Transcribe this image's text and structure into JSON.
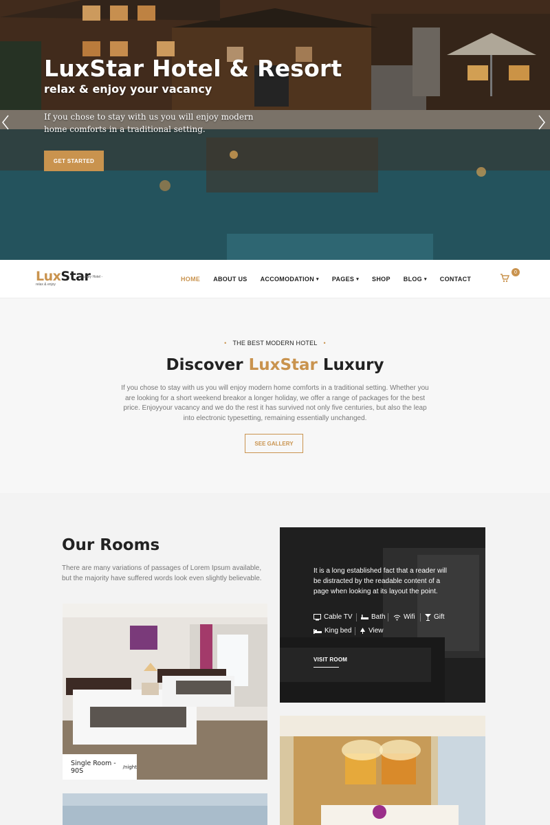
{
  "hero": {
    "title": "LuxStar Hotel & Resort",
    "subtitle": "relax & enjoy your vacancy",
    "text": "If you chose to stay with us you will enjoy modern home comforts in a traditional setting.",
    "button": "GET STARTED",
    "prev_icon": "chevron-left-icon",
    "next_icon": "chevron-right-icon"
  },
  "logo": {
    "lux": "Lux",
    "star": "Star",
    "tagline": "- Luxury Hotel -",
    "sub": "relax & enjoy"
  },
  "nav": {
    "items": [
      {
        "label": "HOME",
        "active": true,
        "dropdown": false
      },
      {
        "label": "ABOUT US",
        "active": false,
        "dropdown": false
      },
      {
        "label": "ACCOMODATION",
        "active": false,
        "dropdown": true
      },
      {
        "label": "PAGES",
        "active": false,
        "dropdown": true
      },
      {
        "label": "SHOP",
        "active": false,
        "dropdown": false
      },
      {
        "label": "BLOG",
        "active": false,
        "dropdown": true
      },
      {
        "label": "CONTACT",
        "active": false,
        "dropdown": false
      }
    ],
    "cart_count": "0"
  },
  "about": {
    "eyebrow": "THE BEST MODERN HOTEL",
    "title_before": "Discover ",
    "title_accent": "LuxStar",
    "title_after": " Luxury",
    "text": "If you chose to stay with us you will enjoy modern home comforts in a traditional setting. Whether you are looking for a short weekend breakor a longer holiday, we offer a range of packages for the best price. Enjoyyour vacancy and we do the rest it has survived not only five centuries, but also the leap into electronic typesetting, remaining essentially unchanged.",
    "button": "SEE GALLERY"
  },
  "rooms": {
    "title": "Our Rooms",
    "text": "There are many variations of passages of Lorem Ipsum available, but the majority have suffered words look even slightly believable.",
    "card1": {
      "name": "Single Room - 90S",
      "per": "/night"
    },
    "dark_card": {
      "text": "It is a long established fact that a reader will be distracted by the readable content of a page when looking at its layout the point.",
      "amenities": [
        {
          "label": "Cable TV",
          "icon": "tv-icon"
        },
        {
          "label": "Bath",
          "icon": "bath-icon"
        },
        {
          "label": "Wifi",
          "icon": "wifi-icon"
        },
        {
          "label": "Gift",
          "icon": "gift-icon"
        },
        {
          "label": "King bed",
          "icon": "bed-icon"
        },
        {
          "label": "View",
          "icon": "view-icon"
        }
      ],
      "link": "VISIT ROOM"
    }
  },
  "colors": {
    "accent": "#c9934e",
    "dark_text": "#222222",
    "muted_text": "#777777",
    "section_bg": "#f7f7f7"
  }
}
